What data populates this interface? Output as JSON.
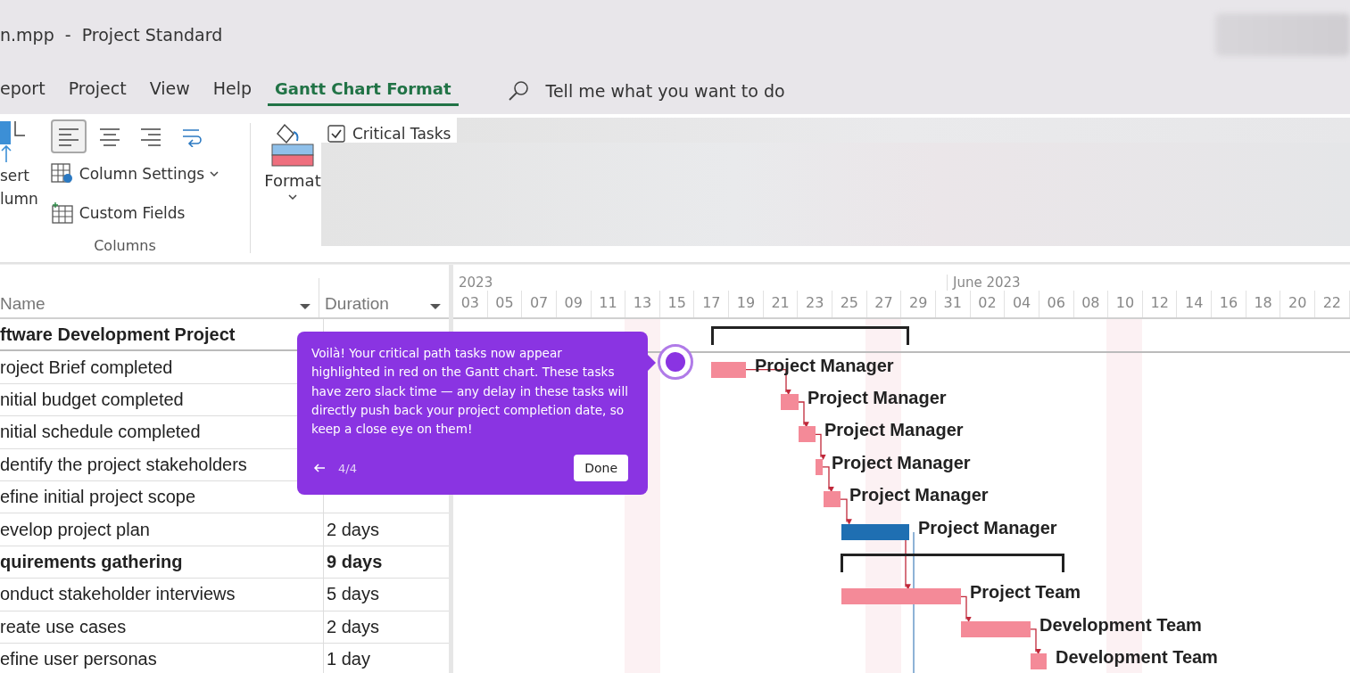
{
  "window": {
    "title": "n.mpp  -  Project Standard"
  },
  "ribbon_tabs": [
    {
      "label": "eport",
      "selected": false
    },
    {
      "label": "Project",
      "selected": false
    },
    {
      "label": "View",
      "selected": false
    },
    {
      "label": "Help",
      "selected": false
    },
    {
      "label": "Gantt Chart Format",
      "selected": true
    }
  ],
  "tell_me": {
    "placeholder": "Tell me what you want to do"
  },
  "ribbon": {
    "insert_column_lines": [
      "sert",
      "lumn"
    ],
    "align_buttons": [
      {
        "kind": "left",
        "selected": true
      },
      {
        "kind": "center",
        "selected": false
      },
      {
        "kind": "right",
        "selected": false
      },
      {
        "kind": "wrap",
        "selected": false
      }
    ],
    "column_settings": "Column Settings",
    "custom_fields": "Custom Fields",
    "columns_group": "Columns",
    "format": "Format",
    "critical_tasks": {
      "label": "Critical Tasks",
      "checked": true
    }
  },
  "table": {
    "columns": [
      "Name",
      "Duration"
    ],
    "rows": [
      {
        "name": "ftware Development Project",
        "summary": true,
        "bar": {
          "kind": "summary"
        }
      },
      {
        "name": "roject Brief completed",
        "summary": false,
        "bar": {
          "kind": "critical",
          "resource": "Project Manager"
        }
      },
      {
        "name": "nitial budget completed",
        "summary": false,
        "bar": {
          "kind": "critical",
          "resource": "Project Manager"
        }
      },
      {
        "name": "nitial schedule completed",
        "summary": false,
        "bar": {
          "kind": "critical",
          "resource": "Project Manager"
        }
      },
      {
        "name": "dentify the project stakeholders",
        "summary": false,
        "bar": {
          "kind": "critical",
          "resource": "Project Manager"
        }
      },
      {
        "name": "efine initial project scope",
        "summary": false,
        "bar": {
          "kind": "critical",
          "resource": "Project Manager"
        }
      },
      {
        "name": "evelop project plan",
        "duration": "2 days",
        "summary": false,
        "bar": {
          "kind": "normal",
          "resource": "Project Manager"
        }
      },
      {
        "name": "quirements gathering",
        "duration": "9 days",
        "summary": true,
        "bar": {
          "kind": "summary"
        }
      },
      {
        "name": "onduct stakeholder interviews",
        "duration": "5 days",
        "summary": false,
        "bar": {
          "kind": "critical",
          "resource": "Project Team"
        }
      },
      {
        "name": "reate use cases",
        "duration": "2 days",
        "summary": false,
        "bar": {
          "kind": "critical",
          "resource": "Development Team"
        }
      },
      {
        "name": "efine user personas",
        "duration": "1 day",
        "summary": false,
        "bar": {
          "kind": "critical",
          "resource": "Development Team"
        }
      }
    ]
  },
  "timeline": {
    "periods": [
      "2023",
      "June 2023"
    ],
    "days": [
      "03",
      "05",
      "07",
      "09",
      "11",
      "13",
      "15",
      "17",
      "19",
      "21",
      "23",
      "25",
      "27",
      "29",
      "31",
      "02",
      "04",
      "06",
      "08",
      "10",
      "12",
      "14",
      "16",
      "18",
      "20",
      "22"
    ]
  },
  "tour": {
    "text": "Voilà! Your critical path tasks now appear highlighted in red on the Gantt chart. These tasks have zero slack time — any delay in these tasks will directly push back your project completion date, so keep a close eye on them!",
    "step": "4/4",
    "button": "Done"
  }
}
